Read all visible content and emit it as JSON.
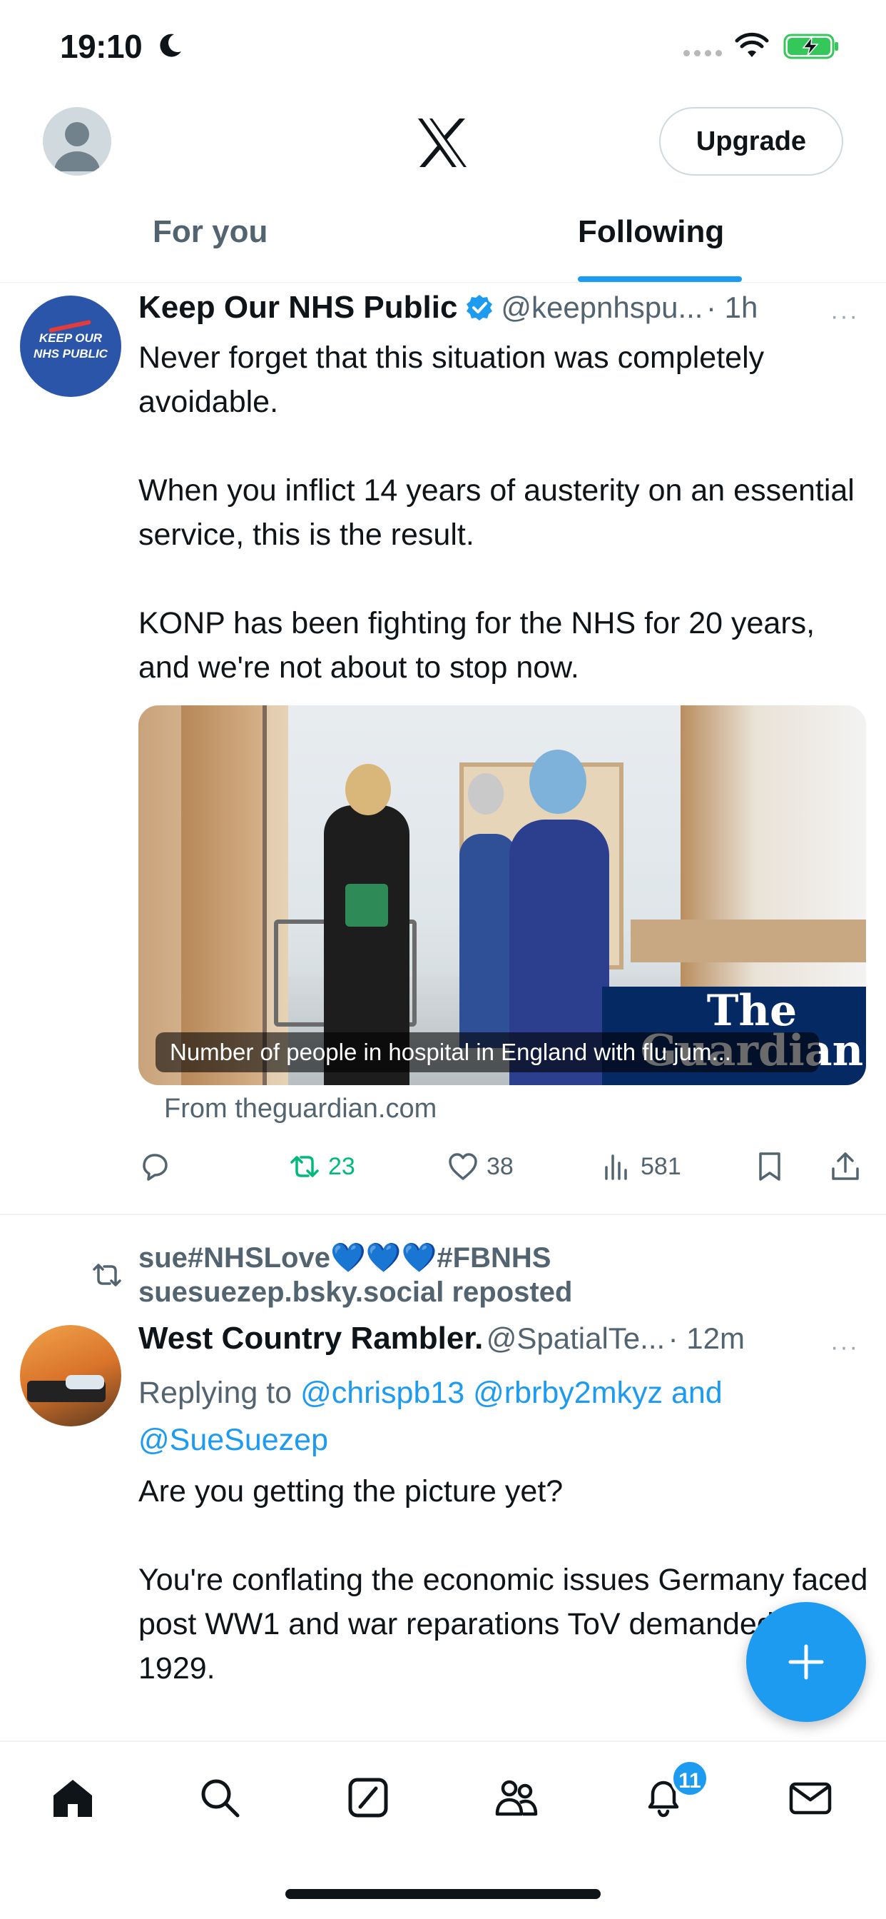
{
  "status": {
    "time": "19:10"
  },
  "header": {
    "upgrade_label": "Upgrade"
  },
  "tabs": [
    {
      "label": "For you"
    },
    {
      "label": "Following"
    }
  ],
  "tweet1": {
    "avatar_text_line1": "KEEP OUR",
    "avatar_text_line2": "NHS PUBLIC",
    "name": "Keep Our NHS Public",
    "handle": "@keepnhspu...",
    "time": "· 1h",
    "more": "···",
    "paragraphs": [
      "Never forget that this situation was completely avoidable.",
      "When you inflict 14 years of austerity on an essential service, this is the result.",
      "KONP has been fighting for the NHS for 20 years, and we're not about to stop now."
    ],
    "card": {
      "caption": "Number of people in hospital in England with flu jum...",
      "logo": "The Guardian",
      "source": "From theguardian.com"
    },
    "stats": {
      "retweets": "23",
      "likes": "38",
      "views": "581"
    }
  },
  "tweet2": {
    "repost_line1_prefix": "sue#NHSLove",
    "repost_hearts": "💙💙💙",
    "repost_line1_suffix": "#FBNHS",
    "repost_line2": "suesuezep.bsky.social reposted",
    "name": "West Country Rambler.",
    "handle": "@SpatialTe...",
    "time": "· 12m",
    "more": "···",
    "replying_prefix": "Replying to",
    "mention1": "@chrispb13",
    "mention2": "@rbrby2mkyz",
    "mention_and": "and",
    "mention3": "@SueSuezep",
    "paragraphs": [
      "Are you getting the picture yet?",
      "You're conflating the economic issues Germany faced post WW1 and war reparations ToV demanded, with 1929."
    ]
  },
  "fab": {
    "icon": "plus-icon"
  },
  "nav": {
    "items": [
      "home-icon",
      "search-icon",
      "grok-icon",
      "communities-icon",
      "notifications-icon",
      "messages-icon"
    ],
    "notifications_badge": "11"
  },
  "colors": {
    "accent": "#1d9bf0",
    "retweet_green": "#00ba7c",
    "muted": "#536471"
  }
}
